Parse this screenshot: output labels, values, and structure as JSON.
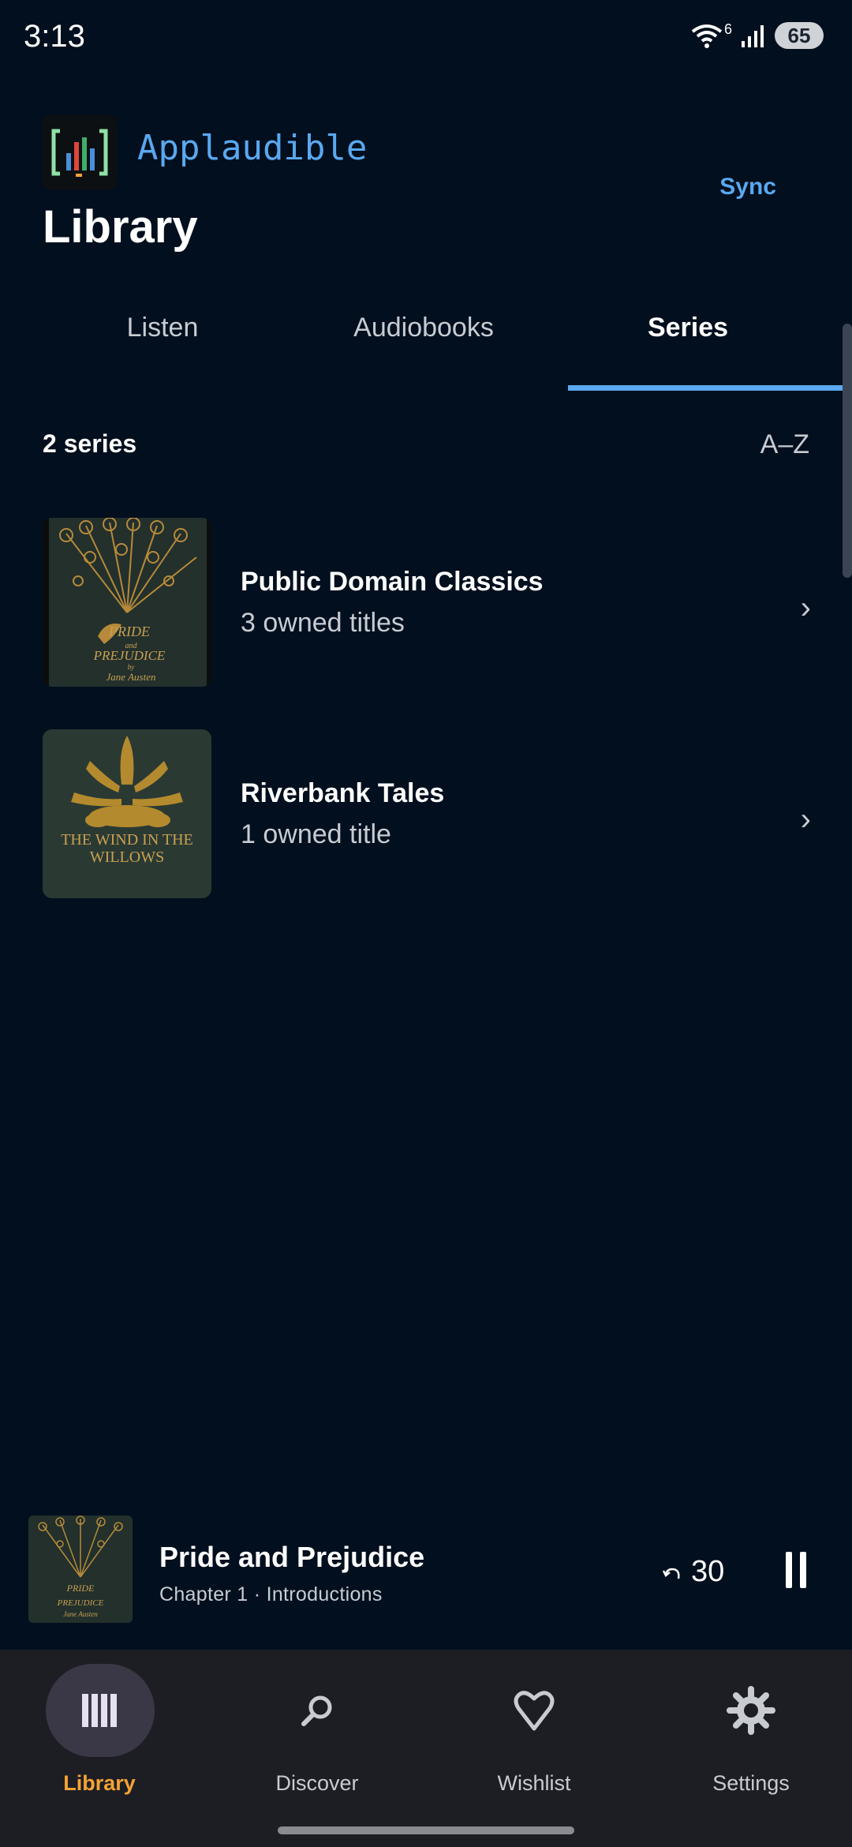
{
  "status": {
    "time": "3:13",
    "wifi_badge": "6",
    "battery": "65"
  },
  "app": {
    "name": "Applaudible",
    "sync_label": "Sync",
    "page_title": "Library"
  },
  "tabs": [
    {
      "label": "Listen",
      "active": false
    },
    {
      "label": "Audiobooks",
      "active": false
    },
    {
      "label": "Series",
      "active": true
    }
  ],
  "list": {
    "count_label": "2 series",
    "sort_label": "A–Z",
    "items": [
      {
        "title": "Public Domain Classics",
        "subtitle": "3 owned titles",
        "cover": "pride-and-prejudice-cover",
        "cover_text": [
          "PRIDE",
          "and",
          "PREJUDICE",
          "by",
          "Jane Austen"
        ]
      },
      {
        "title": "Riverbank Tales",
        "subtitle": "1 owned title",
        "cover": "wind-in-the-willows-cover",
        "cover_text": [
          "THE WIND IN THE",
          "WILLOWS"
        ]
      }
    ]
  },
  "player": {
    "title": "Pride and Prejudice",
    "subtitle": "Chapter 1 · Introductions",
    "skip_seconds": "30",
    "state": "playing"
  },
  "nav": [
    {
      "label": "Library",
      "icon": "library-icon",
      "active": true
    },
    {
      "label": "Discover",
      "icon": "search-icon",
      "active": false
    },
    {
      "label": "Wishlist",
      "icon": "heart-icon",
      "active": false
    },
    {
      "label": "Settings",
      "icon": "gear-icon",
      "active": false
    }
  ],
  "colors": {
    "background": "#020f1e",
    "accent": "#5aa8f0",
    "nav_active": "#f5a234",
    "nav_bg": "#1d1e24"
  }
}
